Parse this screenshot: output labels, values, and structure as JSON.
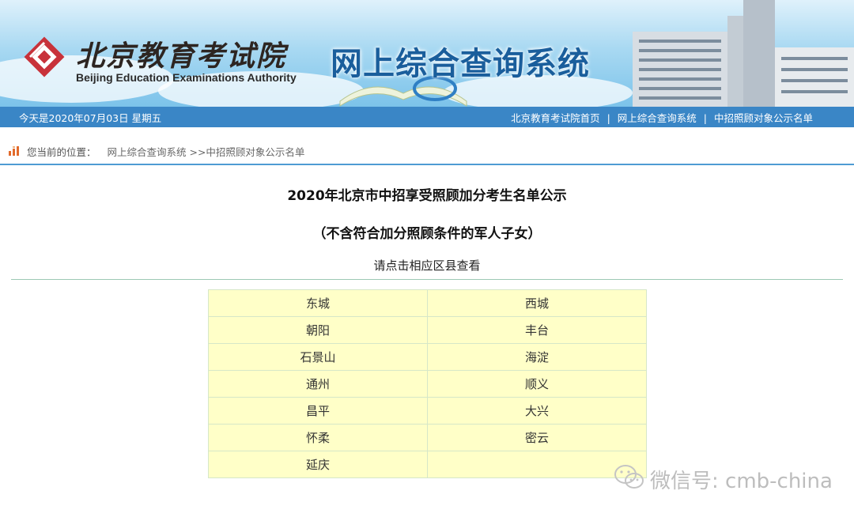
{
  "header": {
    "logo_cn": "北京教育考试院",
    "logo_en": "Beijing Education Examinations Authority",
    "system_title": "网上综合查询系统"
  },
  "topbar": {
    "date": "今天是2020年07月03日  星期五",
    "links": [
      "北京教育考试院首页",
      "网上综合查询系统",
      "中招照顾对象公示名单"
    ],
    "separator": "|"
  },
  "breadcrumb": {
    "prefix": "您当前的位置：",
    "path": "网上综合查询系统 >>中招照顾对象公示名单"
  },
  "main": {
    "title": "2020年北京市中招享受照顾加分考生名单公示",
    "subtitle": "（不含符合加分照顾条件的军人子女）",
    "instruction": "请点击相应区县查看",
    "districts": [
      [
        "东城",
        "西城"
      ],
      [
        "朝阳",
        "丰台"
      ],
      [
        "石景山",
        "海淀"
      ],
      [
        "通州",
        "顺义"
      ],
      [
        "昌平",
        "大兴"
      ],
      [
        "怀柔",
        "密云"
      ],
      [
        "延庆",
        ""
      ]
    ]
  },
  "watermark": {
    "text": "微信号: cmb-china",
    "icon": "wechat-icon"
  },
  "colors": {
    "topbar": "#3a86c6",
    "cell_bg": "#ffffc8",
    "title_blue": "#1a5e9c",
    "logo_red": "#c8323a"
  }
}
